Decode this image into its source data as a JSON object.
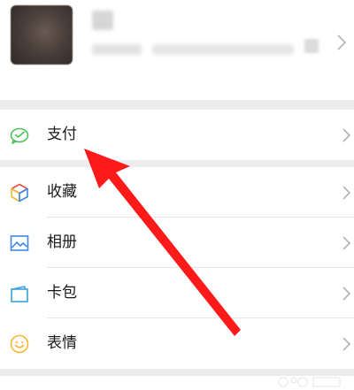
{
  "menu": {
    "pay": "支付",
    "favorites": "收藏",
    "album": "相册",
    "cards": "卡包",
    "stickers": "表情"
  },
  "colors": {
    "pay_icon": "#4cbf5c",
    "album_icon": "#3f88e6",
    "cards_icon": "#3aa3d8",
    "stickers_icon": "#f2b733",
    "annotation_arrow": "#ff1a1a",
    "background": "#ededed"
  },
  "icons": {
    "pay": "wechat-pay-icon",
    "favorites": "cube-icon",
    "album": "picture-icon",
    "cards": "card-wallet-icon",
    "stickers": "smiley-icon",
    "chevron": "chevron-right-icon"
  }
}
